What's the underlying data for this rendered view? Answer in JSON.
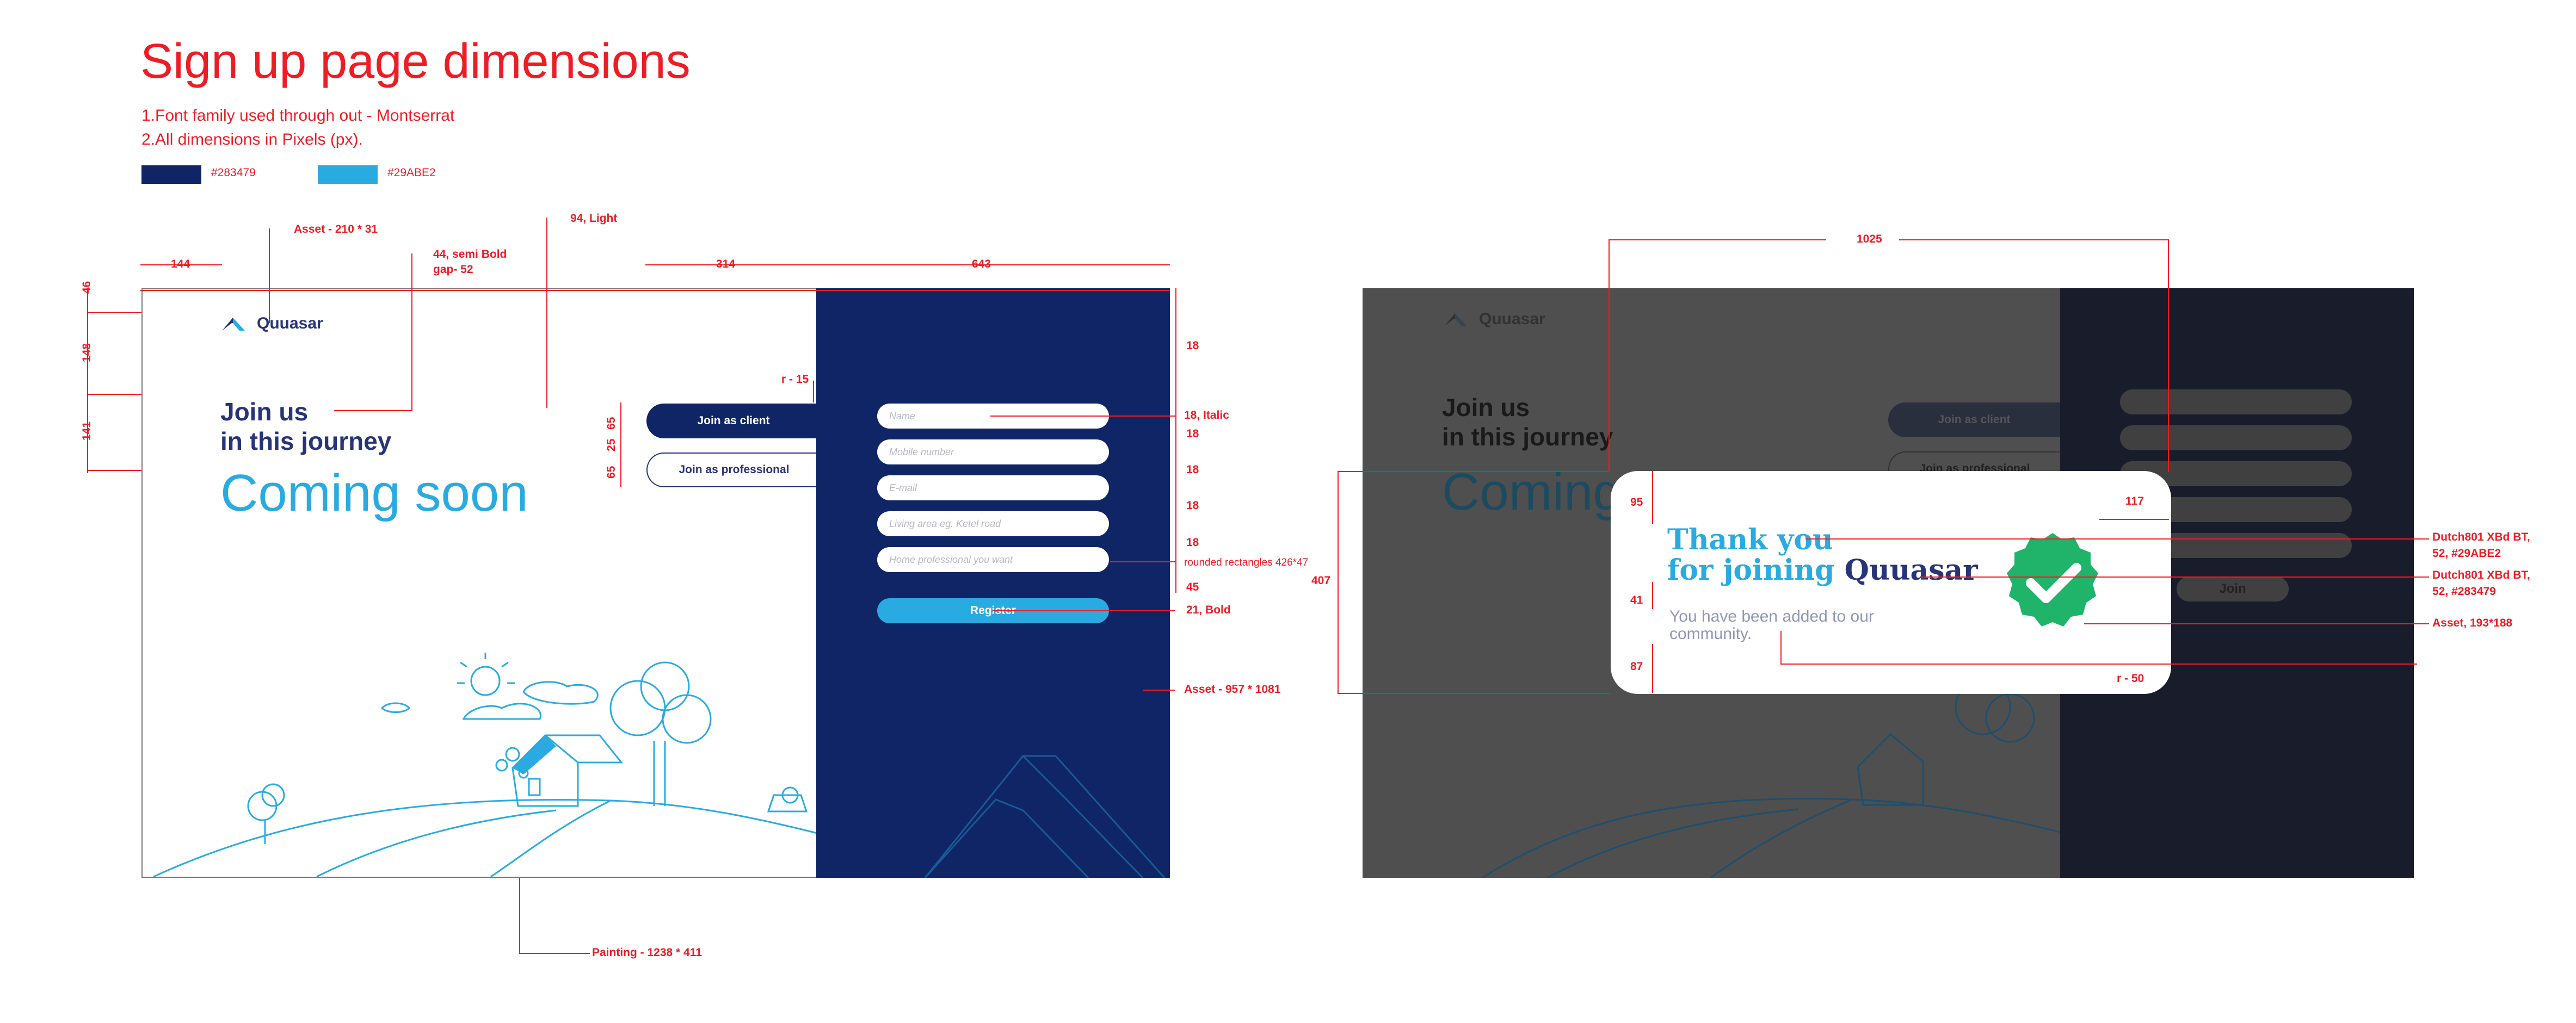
{
  "spec": {
    "title": "Sign up page dimensions",
    "notes": [
      "1.Font family used through out - Montserrat",
      "2.All dimensions in Pixels (px)."
    ],
    "swatches": [
      {
        "label": "#283479",
        "color": "#0f2566"
      },
      {
        "label": "#29ABE2",
        "color": "#29abe2"
      }
    ]
  },
  "annotations": {
    "asset_logo": "Asset - 210 * 31",
    "light_94": "94, Light",
    "semibold_44": "44, semi Bold",
    "gap_52": "gap- 52",
    "w144": "144",
    "w314": "314",
    "w643": "643",
    "h46": "46",
    "h148": "148",
    "h141": "141",
    "r15": "r - 15",
    "h65a": "65",
    "h25": "25",
    "h65b": "65",
    "s18_top": "18",
    "s18_italic": "18, Italic",
    "s18_1": "18",
    "s18_2": "18",
    "s18_3": "18",
    "s18_4": "18",
    "rounded": "rounded rectangles 426*47",
    "s45": "45",
    "bold_21": "21, Bold",
    "asset_right": "Asset - 957 * 1081",
    "painting": "Painting - 1238 * 411",
    "w1025": "1025",
    "h407": "407",
    "h95": "95",
    "h41": "41",
    "h87": "87",
    "w117": "117",
    "r50": "r - 50",
    "font_blue_1": "Dutch801 XBd BT,",
    "font_blue_2": "52, #29ABE2",
    "font_navy_1": "Dutch801 XBd BT,",
    "font_navy_2": "52, #283479",
    "asset_check": "Asset, 193*188"
  },
  "signup": {
    "brand": "Quuasar",
    "heading_line1": "Join us",
    "heading_line2": "in this journey",
    "coming_soon": "Coming soon",
    "tab_client": "Join as client",
    "tab_professional": "Join as professional",
    "fields": [
      {
        "placeholder": "Name"
      },
      {
        "placeholder": "Mobile number"
      },
      {
        "placeholder": "E-mail"
      },
      {
        "placeholder": "Living area eg. Ketel road"
      },
      {
        "placeholder": "Home professional you want"
      }
    ],
    "register": "Register"
  },
  "confirmation": {
    "brand": "Quuasar",
    "heading_line1": "Join us",
    "heading_line2": "in this journey",
    "coming_soon": "Coming soon",
    "tab_client": "Join as client",
    "tab_professional": "Join as professional",
    "join": "Join",
    "thank_line1": "Thank you",
    "thank_line2a": "for joining",
    "thank_line2b": "Quuasar",
    "added": "You have been added to our community."
  },
  "colors": {
    "navy": "#283479",
    "blue": "#29ABE2",
    "check": "#1fb46a"
  },
  "icons": [
    "logo-mark-icon",
    "check-badge-icon"
  ]
}
